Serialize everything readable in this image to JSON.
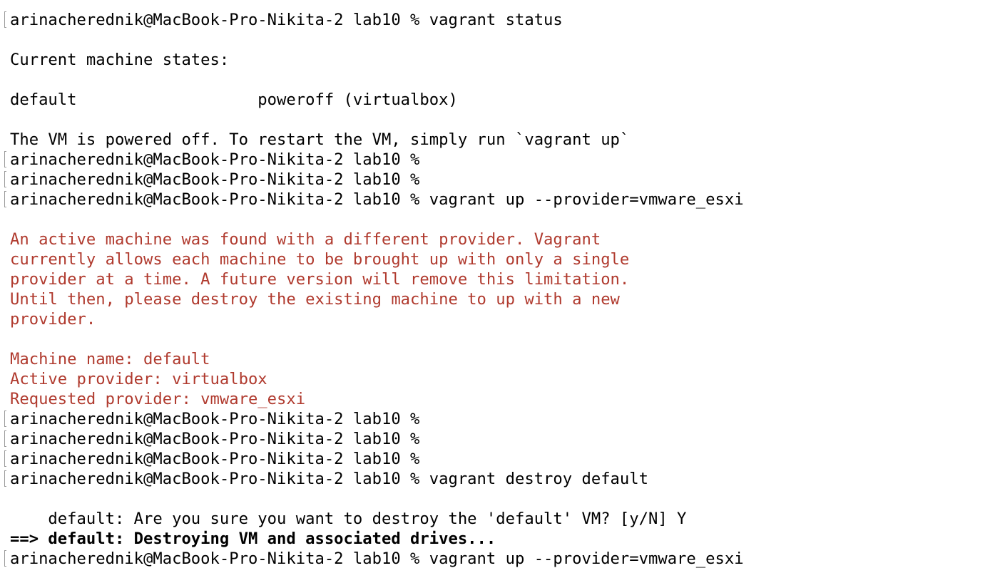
{
  "terminal": {
    "lines": [
      {
        "text": "arinacherednik@MacBook-Pro-Nikita-2 lab10 % vagrant status",
        "kind": "prompt"
      },
      {
        "text": "",
        "kind": "blank"
      },
      {
        "text": "Current machine states:",
        "kind": "output"
      },
      {
        "text": "",
        "kind": "blank"
      },
      {
        "text": "default                   poweroff (virtualbox)",
        "kind": "output"
      },
      {
        "text": "",
        "kind": "blank"
      },
      {
        "text": "The VM is powered off. To restart the VM, simply run `vagrant up`",
        "kind": "output"
      },
      {
        "text": "arinacherednik@MacBook-Pro-Nikita-2 lab10 %",
        "kind": "prompt"
      },
      {
        "text": "arinacherednik@MacBook-Pro-Nikita-2 lab10 %",
        "kind": "prompt"
      },
      {
        "text": "arinacherednik@MacBook-Pro-Nikita-2 lab10 % vagrant up --provider=vmware_esxi",
        "kind": "prompt"
      },
      {
        "text": "",
        "kind": "blank"
      },
      {
        "text": "An active machine was found with a different provider. Vagrant",
        "kind": "error"
      },
      {
        "text": "currently allows each machine to be brought up with only a single",
        "kind": "error"
      },
      {
        "text": "provider at a time. A future version will remove this limitation.",
        "kind": "error"
      },
      {
        "text": "Until then, please destroy the existing machine to up with a new",
        "kind": "error"
      },
      {
        "text": "provider.",
        "kind": "error"
      },
      {
        "text": "",
        "kind": "blank"
      },
      {
        "text": "Machine name: default",
        "kind": "error"
      },
      {
        "text": "Active provider: virtualbox",
        "kind": "error"
      },
      {
        "text": "Requested provider: vmware_esxi",
        "kind": "error"
      },
      {
        "text": "arinacherednik@MacBook-Pro-Nikita-2 lab10 %",
        "kind": "prompt"
      },
      {
        "text": "arinacherednik@MacBook-Pro-Nikita-2 lab10 %",
        "kind": "prompt"
      },
      {
        "text": "arinacherednik@MacBook-Pro-Nikita-2 lab10 %",
        "kind": "prompt"
      },
      {
        "text": "arinacherednik@MacBook-Pro-Nikita-2 lab10 % vagrant destroy default",
        "kind": "prompt"
      },
      {
        "text": "",
        "kind": "blank"
      },
      {
        "text": "    default: Are you sure you want to destroy the 'default' VM? [y/N] Y",
        "kind": "output"
      },
      {
        "text": "==> default: Destroying VM and associated drives...",
        "kind": "status"
      },
      {
        "text": "arinacherednik@MacBook-Pro-Nikita-2 lab10 % vagrant up --provider=vmware_esxi",
        "kind": "prompt"
      }
    ],
    "colors": {
      "text": "#000000",
      "error": "#b03a2e",
      "background": "#ffffff",
      "prompt_mark": "#9a9a9a"
    }
  }
}
